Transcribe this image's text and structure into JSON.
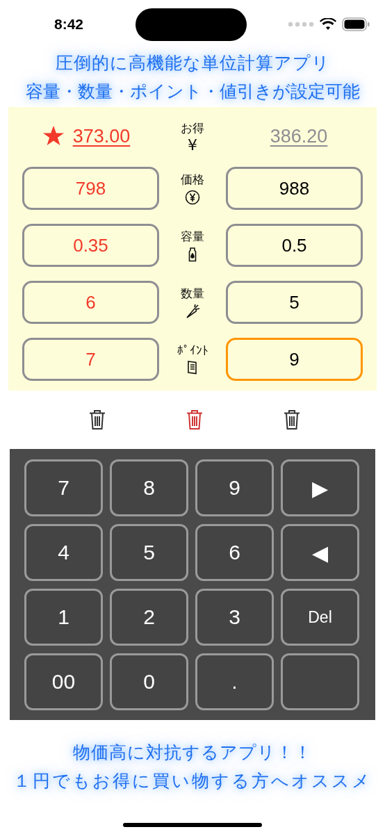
{
  "status_bar": {
    "time": "8:42"
  },
  "headline": [
    "圧倒的に高機能な単位計算アプリ",
    "容量・数量・ポイント・値引きが設定可能"
  ],
  "result": {
    "label": "お得",
    "symbol": "¥",
    "left": {
      "value": "373.00",
      "best": true
    },
    "right": {
      "value": "386.20",
      "best": false
    }
  },
  "fields": [
    {
      "label": "価格",
      "kind": "yen",
      "left": {
        "value": "798",
        "selected": false
      },
      "right": {
        "value": "988",
        "selected": false
      }
    },
    {
      "label": "容量",
      "kind": "bottle",
      "left": {
        "value": "0.35",
        "selected": false
      },
      "right": {
        "value": "0.5",
        "selected": false
      }
    },
    {
      "label": "数量",
      "kind": "carrot",
      "left": {
        "value": "6",
        "selected": false
      },
      "right": {
        "value": "5",
        "selected": false
      }
    },
    {
      "label": "ﾎﾟｲﾝﾄ",
      "kind": "card",
      "left": {
        "value": "7",
        "selected": false
      },
      "right": {
        "value": "9",
        "selected": true
      }
    }
  ],
  "trash_buttons": [
    {
      "color": "#333333"
    },
    {
      "color": "#d03434"
    },
    {
      "color": "#333333"
    }
  ],
  "keypad": [
    {
      "label": "7"
    },
    {
      "label": "8"
    },
    {
      "label": "9"
    },
    {
      "label": "▶"
    },
    {
      "label": "4"
    },
    {
      "label": "5"
    },
    {
      "label": "6"
    },
    {
      "label": "◀"
    },
    {
      "label": "1"
    },
    {
      "label": "2"
    },
    {
      "label": "3"
    },
    {
      "label": "Del"
    },
    {
      "label": "00"
    },
    {
      "label": "0"
    },
    {
      "label": "."
    },
    {
      "kind": "blank"
    }
  ],
  "footer": [
    "物価高に対抗するアプリ！！",
    "１円でもお得に買い物する方へオススメ"
  ]
}
